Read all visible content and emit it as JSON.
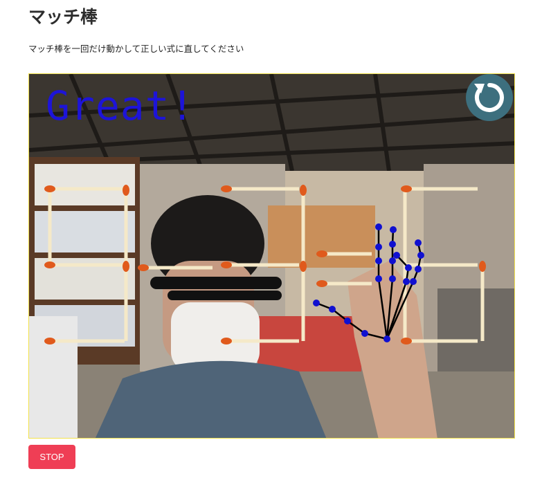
{
  "page": {
    "title": "マッチ棒",
    "instruction": "マッチ棒を一回だけ動かして正しい式に直してください"
  },
  "camera": {
    "overlay_text": "Great!",
    "overlay_color": "#1d14d8",
    "reset_icon": "refresh-icon"
  },
  "controls": {
    "stop_label": "STOP",
    "stop_color": "#ef3e55"
  }
}
